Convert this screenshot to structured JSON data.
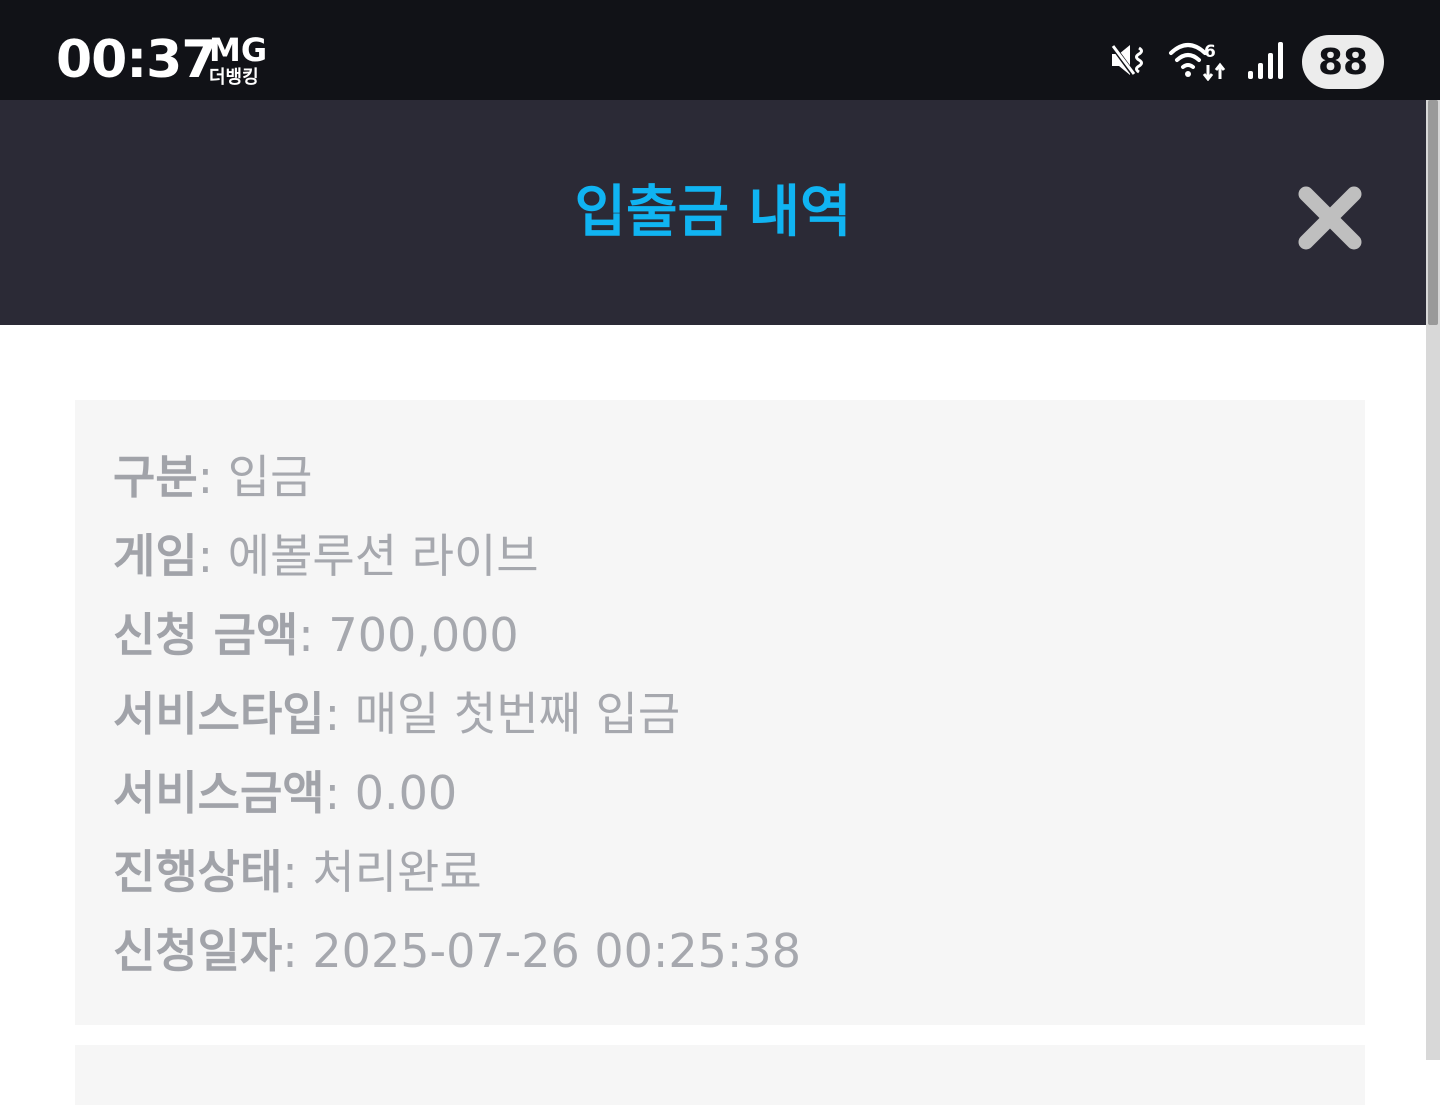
{
  "status_bar": {
    "time": "00:37",
    "carrier_top": "MG",
    "carrier_bottom": "더뱅킹",
    "battery": "88",
    "icons": [
      "mute-vibrate-icon",
      "wifi-6-icon",
      "signal-icon",
      "battery-icon"
    ]
  },
  "header": {
    "title": "입출금 내역",
    "close_icon": "close-icon"
  },
  "record": {
    "rows": [
      {
        "label": "구분",
        "value": "입금"
      },
      {
        "label": "게임",
        "value": "에볼루션 라이브"
      },
      {
        "label": "신청 금액",
        "value": "700,000"
      },
      {
        "label": "서비스타입",
        "value": "매일 첫번째 입금"
      },
      {
        "label": "서비스금액",
        "value": "0.00"
      },
      {
        "label": "진행상태",
        "value": "처리완료"
      },
      {
        "label": "신청일자",
        "value": "2025-07-26 00:25:38"
      }
    ]
  },
  "colors": {
    "status_bg": "#111217",
    "header_bg": "#2b2a36",
    "title_accent": "#10b4f2",
    "card_bg": "#f6f6f6",
    "text_gray": "#a6a8ae",
    "close_gray": "#bfbfbf"
  }
}
